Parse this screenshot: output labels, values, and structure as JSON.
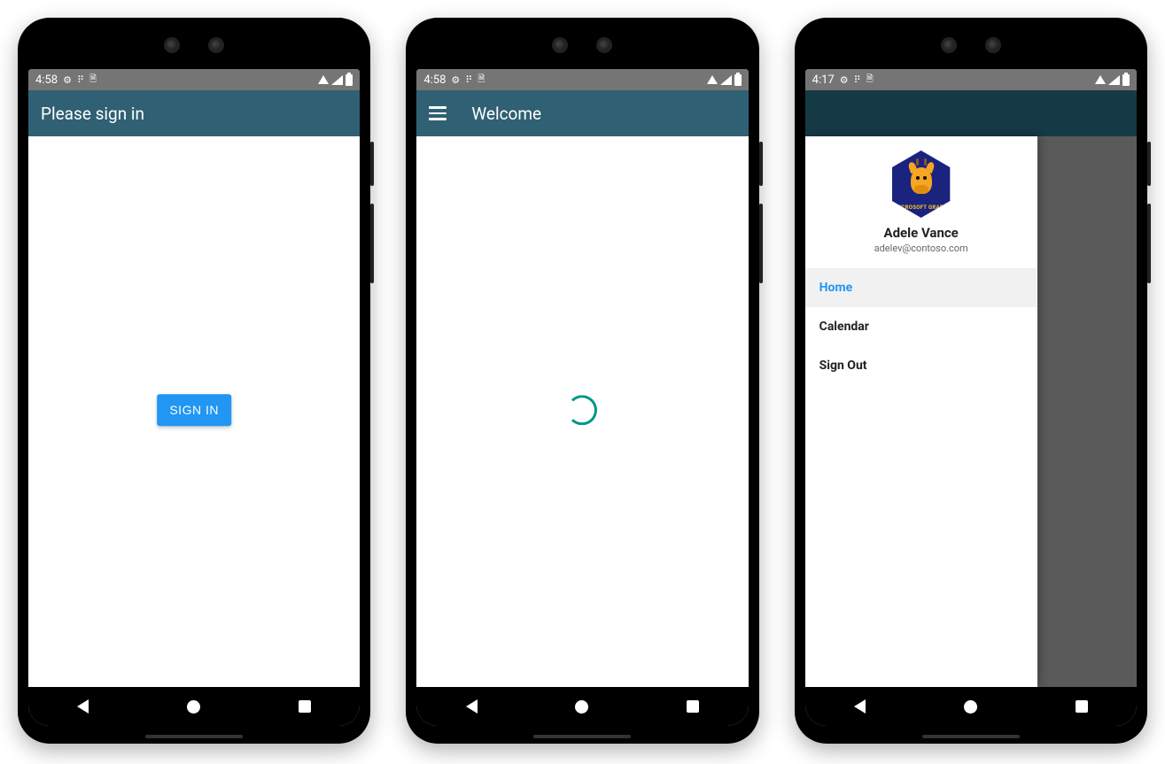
{
  "colors": {
    "appbar": "#2f6074",
    "accent_button": "#2196f3",
    "spinner": "#009688"
  },
  "phone1": {
    "status_time": "4:58",
    "appbar_title": "Please sign in",
    "signin_button_label": "SIGN IN"
  },
  "phone2": {
    "status_time": "4:58",
    "appbar_title": "Welcome"
  },
  "phone3": {
    "status_time": "4:17",
    "user": {
      "name": "Adele Vance",
      "email": "adelev@contoso.com",
      "avatar_badge": "MICROSOFT GRAPH"
    },
    "drawer_items": [
      {
        "label": "Home",
        "active": true
      },
      {
        "label": "Calendar",
        "active": false
      },
      {
        "label": "Sign Out",
        "active": false
      }
    ]
  }
}
